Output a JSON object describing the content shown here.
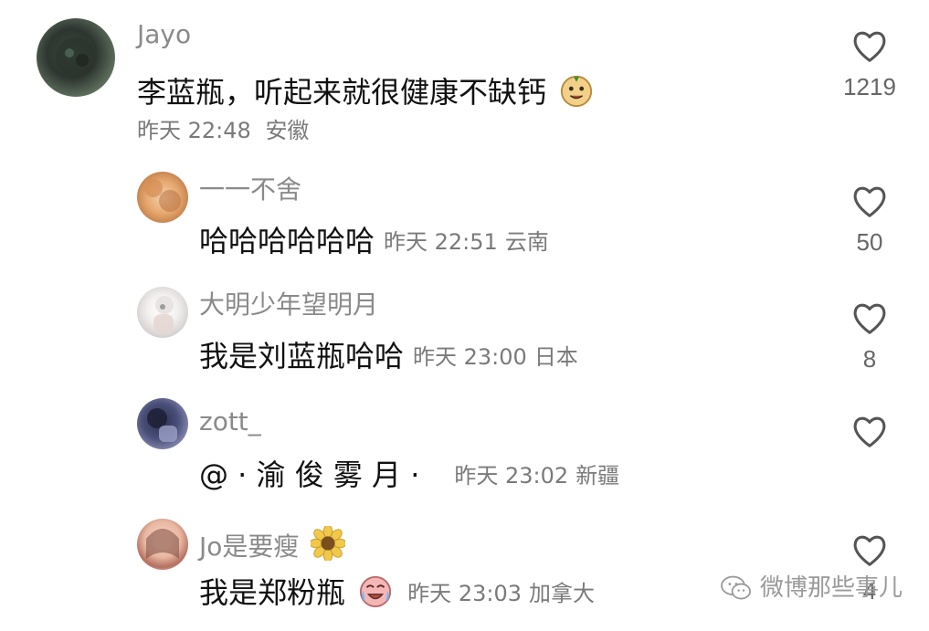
{
  "comments": [
    {
      "username": "Jayo",
      "text": "李蓝瓶，听起来就很健康不缺钙",
      "time": "昨天 22:48",
      "location": "安徽",
      "likes": "1219"
    }
  ],
  "replies": [
    {
      "username": "一一不舍",
      "text": "哈哈哈哈哈哈",
      "time": "昨天 22:51",
      "location": "云南",
      "likes": "50"
    },
    {
      "username": "大明少年望明月",
      "text": "我是刘蓝瓶哈哈",
      "time": "昨天 23:00",
      "location": "日本",
      "likes": "8"
    },
    {
      "username": "zott_",
      "text": "@ · 渝 俊 雾 月 ·",
      "time": "昨天 23:02",
      "location": "新疆",
      "likes": ""
    },
    {
      "username": "Jo是要瘦",
      "text": "我是郑粉瓶",
      "time": "昨天 23:03",
      "location": "加拿大",
      "likes": "4"
    }
  ],
  "watermark": {
    "text": "微博那些事儿"
  },
  "colors": {
    "heart_stroke": "#555555",
    "meta_text": "#7a7a7a",
    "username_text": "#8a8a8a"
  },
  "icons": [
    "heart-icon",
    "smile-face-sticker",
    "sunflower-sticker",
    "crying-laugh-sticker",
    "wechat-icon"
  ]
}
